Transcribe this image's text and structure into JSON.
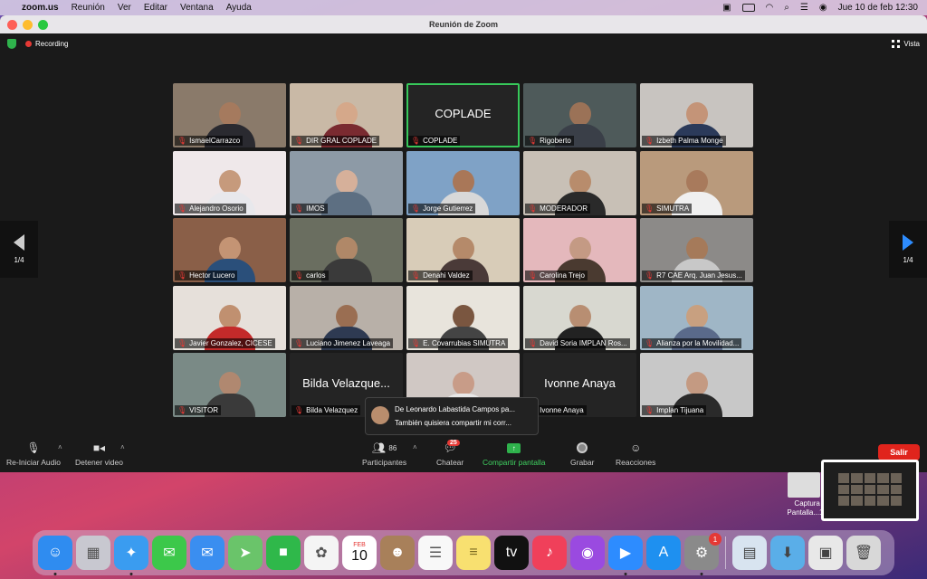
{
  "menubar": {
    "app": "zoom.us",
    "menus": [
      "Reunión",
      "Ver",
      "Editar",
      "Ventana",
      "Ayuda"
    ],
    "datetime": "Jue 10 de feb  12:30"
  },
  "window": {
    "title": "Reunión de Zoom",
    "recording_label": "Recording",
    "view_label": "Vista"
  },
  "pagination": {
    "left": "1/4",
    "right": "1/4"
  },
  "participants": [
    {
      "name": "IsmaelCarrazco",
      "bg": "#8a7a6a",
      "skin": "#a57a5e",
      "shirt": "#2a2a30"
    },
    {
      "name": "DIR GRAL COPLADE",
      "bg": "#c9b9a6",
      "skin": "#d5a88a",
      "shirt": "#7a2a30"
    },
    {
      "name": "COPLADE",
      "big": "COPLADE",
      "bg": "#242424"
    },
    {
      "name": "Rigoberto",
      "bg": "#4e5a5a",
      "skin": "#9b7257",
      "shirt": "#3a3f48"
    },
    {
      "name": "Izbeth Palma Monge",
      "bg": "#c8c4c0",
      "skin": "#c49478",
      "shirt": "#2b3a5a"
    },
    {
      "name": "Alejandro Osorio",
      "bg": "#efe8ea",
      "skin": "#c69a7c",
      "shirt": "#e8e8ec"
    },
    {
      "name": "IMOS",
      "bg": "#8d9aa6",
      "skin": "#d6b09a",
      "shirt": "#5d6f82"
    },
    {
      "name": "Jorge Gutierrez",
      "bg": "#7fa2c6",
      "skin": "#a97758",
      "shirt": "#d8d8d8"
    },
    {
      "name": "MODERADOR",
      "bg": "#c8c0b6",
      "skin": "#b88c6c",
      "shirt": "#2a2a2a"
    },
    {
      "name": "SIMUTRA",
      "bg": "#b99a7c",
      "skin": "#a87a5c",
      "shirt": "#f0f0f0"
    },
    {
      "name": "Hector Lucero",
      "bg": "#8a5f48",
      "skin": "#c49474",
      "shirt": "#2a4f7a"
    },
    {
      "name": "carlos",
      "bg": "#6a6e60",
      "skin": "#b08868",
      "shirt": "#3a3a3a"
    },
    {
      "name": "Denahi Valdez",
      "bg": "#d8ccb8",
      "skin": "#b58a6a",
      "shirt": "#4a3a38"
    },
    {
      "name": "Carolina Trejo",
      "bg": "#e4b8bc",
      "skin": "#c49a84",
      "shirt": "#4a3a30"
    },
    {
      "name": "R7 CAE Arq. Juan Jesus...",
      "bg": "#8c8a88",
      "skin": "#a57a5a",
      "shirt": "#c8c8c8"
    },
    {
      "name": "Javier Gonzalez, CICESE",
      "bg": "#e6e0da",
      "skin": "#c09070",
      "shirt": "#c42a2a"
    },
    {
      "name": "Luciano Jimenez Laveaga",
      "bg": "#b8b0a8",
      "skin": "#9a6e52",
      "shirt": "#2e3a52"
    },
    {
      "name": "E. Covarrubias SIMUTRA",
      "bg": "#e8e4dc",
      "skin": "#7a5640",
      "shirt": "#444444"
    },
    {
      "name": "David Soria IMPLAN Ros...",
      "bg": "#d8d8d0",
      "skin": "#b88e72",
      "shirt": "#222222"
    },
    {
      "name": "Alianza por la Movilidad...",
      "bg": "#9fb6c6",
      "skin": "#c8a080",
      "shirt": "#5a6a8a"
    },
    {
      "name": "VISITOR",
      "bg": "#7a8a86",
      "skin": "#b08870",
      "shirt": "#3a3a3a"
    },
    {
      "name": "Bilda Velazquez",
      "big": "Bilda Velazque...",
      "bg": "#242424"
    },
    {
      "name": "",
      "bg": "#d0c8c4",
      "skin": "#c89c88",
      "shirt": "#e8e8e8"
    },
    {
      "name": "Ivonne Anaya",
      "big": "Ivonne Anaya",
      "bg": "#242424"
    },
    {
      "name": "Implan Tijuana",
      "bg": "#c8c8c8",
      "skin": "#c49a82",
      "shirt": "#2a2a2a"
    }
  ],
  "chat_popup": {
    "from": "De Leonardo Labastida Campos pa...",
    "message": "También quisiera compartir mi corr..."
  },
  "toolbar": {
    "audio_label": "Re-Iniciar Audio",
    "video_label": "Detener video",
    "participants_label": "Participantes",
    "participants_count": "86",
    "chat_label": "Chatear",
    "chat_badge": "25",
    "share_label": "Compartir pantalla",
    "record_label": "Grabar",
    "reactions_label": "Reacciones",
    "leave_label": "Salir"
  },
  "desktop": {
    "screenshot_label_1": "Captura d",
    "screenshot_label_2": "Pantalla...12.0"
  },
  "dock": {
    "calendar_month": "FEB",
    "calendar_day": "10",
    "settings_badge": "1",
    "apps": [
      {
        "name": "finder-icon",
        "color": "#2f8cf0",
        "glyph": "☺"
      },
      {
        "name": "launchpad-icon",
        "color": "#c8c8d0",
        "glyph": "▦"
      },
      {
        "name": "safari-icon",
        "color": "#3a9cf0",
        "glyph": "✦"
      },
      {
        "name": "messages-icon",
        "color": "#3cc84a",
        "glyph": "✉"
      },
      {
        "name": "mail-icon",
        "color": "#3a8ef0",
        "glyph": "✉"
      },
      {
        "name": "maps-icon",
        "color": "#6ac46a",
        "glyph": "➤"
      },
      {
        "name": "facetime-icon",
        "color": "#2fb84a",
        "glyph": "■"
      },
      {
        "name": "photos-icon",
        "color": "#f4f4f4",
        "glyph": "✿"
      },
      {
        "name": "calendar-icon",
        "color": "#ffffff",
        "glyph": ""
      },
      {
        "name": "contacts-icon",
        "color": "#a8805a",
        "glyph": "☻"
      },
      {
        "name": "reminders-icon",
        "color": "#f8f8f8",
        "glyph": "☰"
      },
      {
        "name": "notes-icon",
        "color": "#f8e070",
        "glyph": "≡"
      },
      {
        "name": "tv-icon",
        "color": "#111111",
        "glyph": "tv"
      },
      {
        "name": "music-icon",
        "color": "#f0405a",
        "glyph": "♪"
      },
      {
        "name": "podcasts-icon",
        "color": "#9a4ae0",
        "glyph": "◉"
      },
      {
        "name": "zoom-icon",
        "color": "#2d8cff",
        "glyph": "▶"
      },
      {
        "name": "app-store-icon",
        "color": "#1e90f0",
        "glyph": "A"
      },
      {
        "name": "system-preferences-icon",
        "color": "#8a8a8a",
        "glyph": "⚙"
      }
    ]
  }
}
